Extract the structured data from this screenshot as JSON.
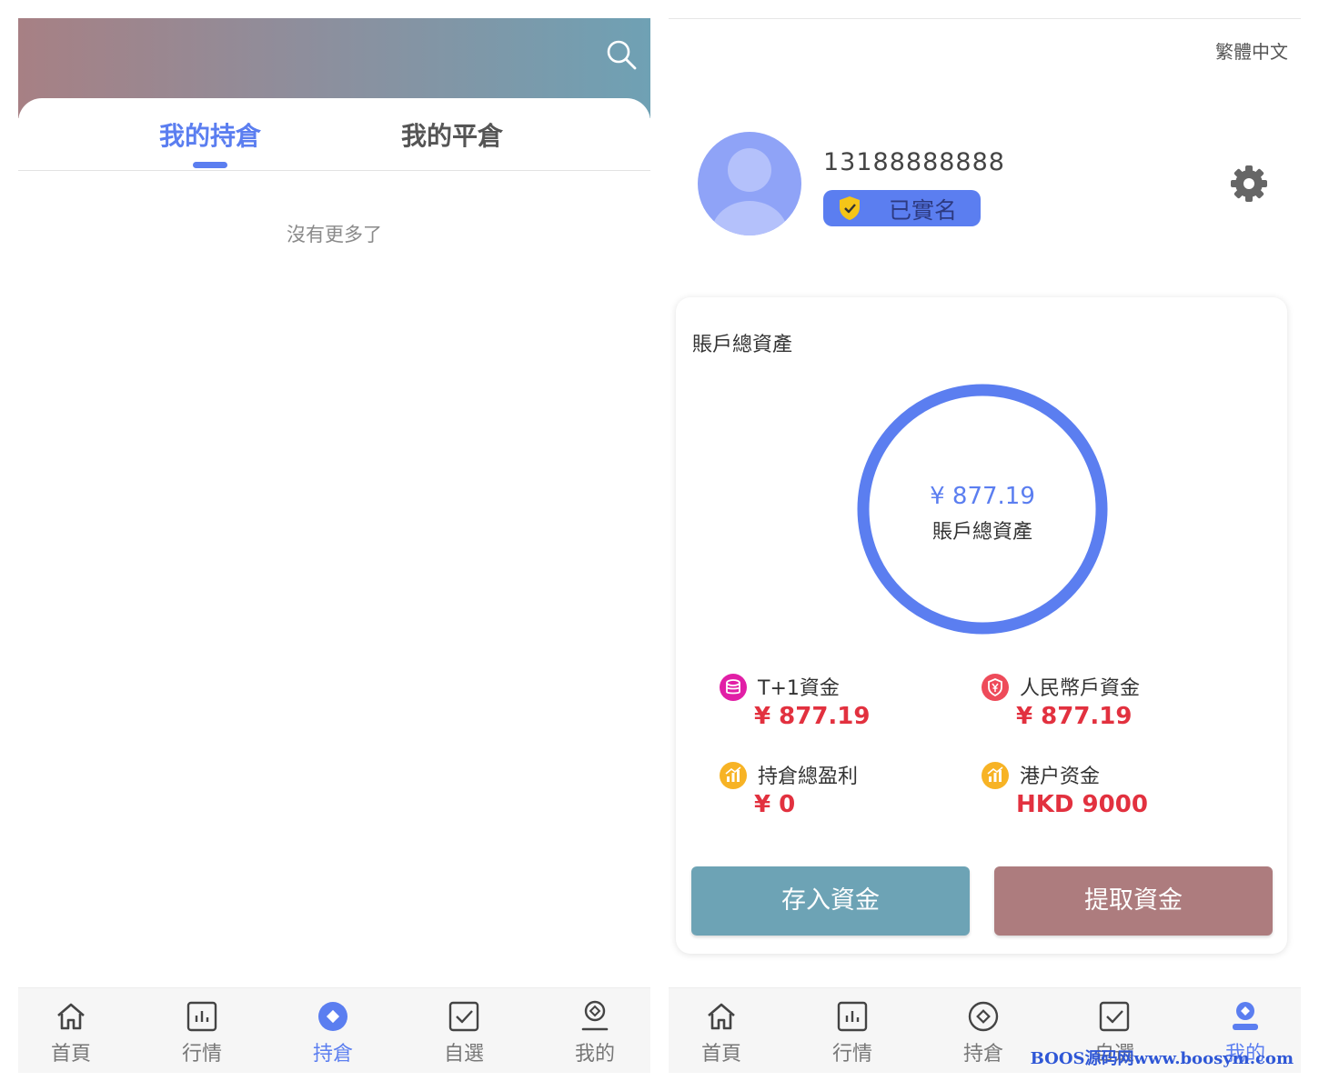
{
  "left": {
    "tabs": [
      {
        "label": "我的持倉",
        "active": true
      },
      {
        "label": "我的平倉",
        "active": false
      }
    ],
    "empty_text": "沒有更多了",
    "header_gradient": [
      "#a78084",
      "#6fa1b4"
    ]
  },
  "right": {
    "language": "繁體中文",
    "user": {
      "phone": "13188888888",
      "verified_label": "已實名"
    },
    "assets": {
      "title": "賬戶總資產",
      "total": "¥ 877.19",
      "total_label": "賬戶總資產",
      "items": [
        {
          "name": "T+1資金",
          "value": "¥ 877.19",
          "icon": "database-coin-icon"
        },
        {
          "name": "人民幣戶資金",
          "value": "¥ 877.19",
          "icon": "yuan-shield-icon"
        },
        {
          "name": "持倉總盈利",
          "value": "¥ 0",
          "icon": "chart-coin-icon"
        },
        {
          "name": "港户资金",
          "value": "HKD 9000",
          "icon": "chart-coin-icon"
        }
      ]
    },
    "buttons": {
      "deposit": "存入資金",
      "withdraw": "提取資金"
    },
    "watermark": "BOOS源码网www.boosym.com"
  },
  "nav": {
    "items": [
      "首頁",
      "行情",
      "持倉",
      "自選",
      "我的"
    ]
  },
  "colors": {
    "accent": "#5b7ef0",
    "danger": "#e2313f",
    "deposit": "#6da3b5",
    "withdraw": "#ad7c7e"
  }
}
